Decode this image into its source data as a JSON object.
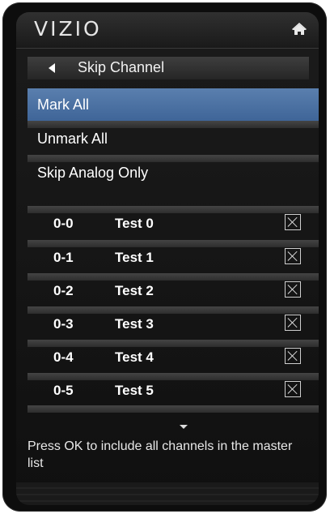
{
  "header": {
    "brand": "VIZIO",
    "home_icon": "home-icon"
  },
  "nav": {
    "back_icon": "back-arrow-icon",
    "title": "Skip Channel"
  },
  "menu": {
    "items": [
      {
        "label": "Mark All",
        "selected": true
      },
      {
        "label": "Unmark All",
        "selected": false
      },
      {
        "label": "Skip Analog Only",
        "selected": false
      }
    ]
  },
  "channels": [
    {
      "number": "0-0",
      "name": "Test 0",
      "skipped": true
    },
    {
      "number": "0-1",
      "name": "Test 1",
      "skipped": true
    },
    {
      "number": "0-2",
      "name": "Test 2",
      "skipped": true
    },
    {
      "number": "0-3",
      "name": "Test 3",
      "skipped": true
    },
    {
      "number": "0-4",
      "name": "Test 4",
      "skipped": true
    },
    {
      "number": "0-5",
      "name": "Test 5",
      "skipped": true
    }
  ],
  "hint": "Press OK to include all channels in the master list",
  "colors": {
    "selected": "#4a70a3",
    "text": "#ffffff"
  }
}
